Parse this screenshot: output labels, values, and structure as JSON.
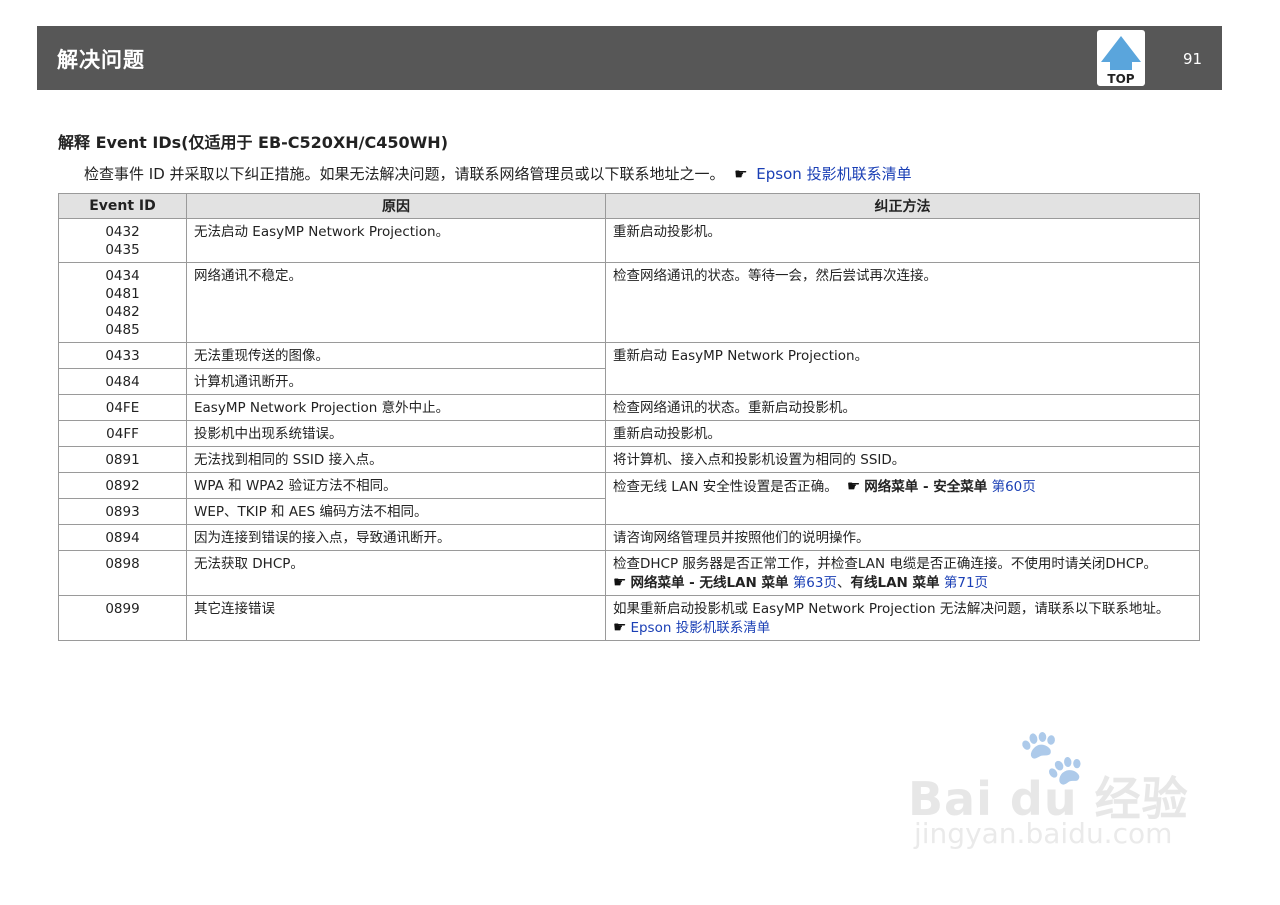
{
  "header": {
    "title": "解决问题",
    "top_label": "TOP",
    "page_number": "91"
  },
  "section_title": "解释 Event IDs(仅适用于 EB-C520XH/C450WH)",
  "intro": {
    "text": "检查事件 ID 并采取以下纠正措施。如果无法解决问题，请联系网络管理员或以下联系地址之一。",
    "link": "Epson 投影机联系清单"
  },
  "table": {
    "headers": [
      "Event ID",
      "原因",
      "纠正方法"
    ],
    "rows": [
      {
        "ids": [
          "0432",
          "0435"
        ],
        "cause": "无法启动 EasyMP Network Projection。",
        "fix": "重新启动投影机。"
      },
      {
        "ids": [
          "0434",
          "0481",
          "0482",
          "0485"
        ],
        "cause": "网络通讯不稳定。",
        "fix": "检查网络通讯的状态。等待一会，然后尝试再次连接。"
      },
      {
        "ids": [
          "0433"
        ],
        "cause": "无法重现传送的图像。",
        "fix": "重新启动 EasyMP Network Projection。"
      },
      {
        "ids": [
          "0484"
        ],
        "cause": "计算机通讯断开。"
      },
      {
        "ids": [
          "04FE"
        ],
        "cause": "EasyMP Network Projection 意外中止。",
        "fix": "检查网络通讯的状态。重新启动投影机。"
      },
      {
        "ids": [
          "04FF"
        ],
        "cause": "投影机中出现系统错误。",
        "fix": "重新启动投影机。"
      },
      {
        "ids": [
          "0891"
        ],
        "cause": "无法找到相同的 SSID 接入点。",
        "fix": "将计算机、接入点和投影机设置为相同的 SSID。"
      },
      {
        "ids": [
          "0892"
        ],
        "cause": "WPA 和 WPA2 验证方法不相同。",
        "fix_parts": [
          "检查无线 LAN 安全性设置是否正确。",
          "网络菜单 - 安全菜单",
          "第60页"
        ]
      },
      {
        "ids": [
          "0893"
        ],
        "cause": "WEP、TKIP 和 AES 编码方法不相同。"
      },
      {
        "ids": [
          "0894"
        ],
        "cause": "因为连接到错误的接入点，导致通讯断开。",
        "fix": "请咨询网络管理员并按照他们的说明操作。"
      },
      {
        "ids": [
          "0898"
        ],
        "cause": "无法获取 DHCP。",
        "fix_parts": [
          "检查DHCP 服务器是否正常工作，并检查LAN 电缆是否正确连接。不使用时请关闭DHCP。",
          "网络菜单 - 无线LAN 菜单",
          "第63页",
          "、",
          "有线LAN 菜单",
          "第71页"
        ]
      },
      {
        "ids": [
          "0899"
        ],
        "cause": "其它连接错误",
        "fix_parts": [
          "如果重新启动投影机或 EasyMP Network Projection 无法解决问题，请联系以下联系地址。",
          "Epson 投影机联系清单"
        ]
      }
    ]
  },
  "watermark": {
    "main": "Bai du 经验",
    "sub": "jingyan.baidu.com"
  }
}
